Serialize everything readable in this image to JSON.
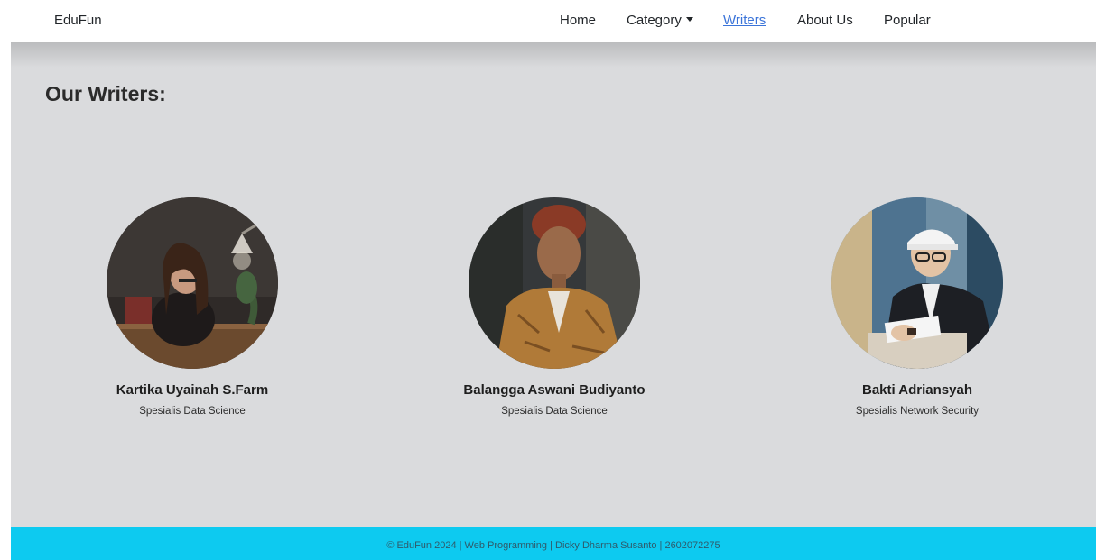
{
  "navbar": {
    "brand": "EduFun",
    "items": [
      {
        "label": "Home"
      },
      {
        "label": "Category"
      },
      {
        "label": "Writers"
      },
      {
        "label": "About Us"
      },
      {
        "label": "Popular"
      }
    ],
    "active_index": 2,
    "active_color": "#3b74d9"
  },
  "page": {
    "title": "Our Writers:"
  },
  "writers": [
    {
      "name": "Kartika Uyainah S.Farm",
      "role": "Spesialis Data Science",
      "photo_icon": "writer-photo"
    },
    {
      "name": "Balangga Aswani Budiyanto",
      "role": "Spesialis Data Science",
      "photo_icon": "writer-photo"
    },
    {
      "name": "Bakti Adriansyah",
      "role": "Spesialis Network Security",
      "photo_icon": "writer-photo"
    }
  ],
  "footer": {
    "text": "© EduFun 2024 | Web Programming | Dicky Dharma Susanto | 2602072275",
    "background": "#0dcaf0"
  },
  "colors": {
    "content_background": "#dadbdd",
    "navbar_background": "#ffffff"
  }
}
